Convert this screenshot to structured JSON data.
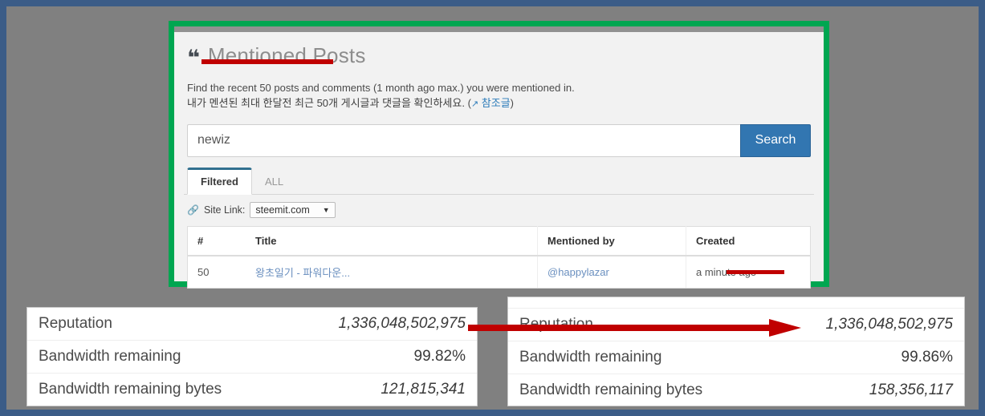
{
  "frame": {
    "border_color": "#3b5c87",
    "background_color": "#808080"
  },
  "annotations": {
    "highlight_box_color": "#00a651",
    "underline_color": "#c00000",
    "arrow_color": "#c00000"
  },
  "card": {
    "quote_icon": "quote-icon",
    "title": "Mentioned Posts",
    "description_en": "Find the recent 50 posts and comments (1 month ago max.) you were mentioned in.",
    "description_kr": "내가 멘션된 최대 한달전 최근 50개 게시글과 댓글을 확인하세요.",
    "ref_open_paren": "(",
    "ref_link_label": "참조글",
    "ref_close_paren": ")",
    "search": {
      "value": "newiz",
      "placeholder": "",
      "button_label": "Search",
      "button_color": "#3276b1"
    },
    "tabs": [
      {
        "label": "Filtered",
        "active": true
      },
      {
        "label": "ALL",
        "active": false
      }
    ],
    "site_link": {
      "icon": "chain-link-icon",
      "label": "Site Link:",
      "selected": "steemit.com",
      "caret": "▼",
      "options": [
        "steemit.com"
      ]
    },
    "table": {
      "headers": {
        "num": "#",
        "title": "Title",
        "mentioned_by": "Mentioned by",
        "created": "Created"
      },
      "rows": [
        {
          "num": "50",
          "title": "왕초일기 - 파워다운...",
          "mentioned_by": "@happylazar",
          "created": "a minute ago"
        }
      ]
    }
  },
  "panel_left": {
    "rows": [
      {
        "label": "Reputation",
        "value": "1,336,048,502,975",
        "italic": true
      },
      {
        "label": "Bandwidth remaining",
        "value": "99.82%",
        "italic": false
      },
      {
        "label": "Bandwidth remaining bytes",
        "value": "121,815,341",
        "italic": true
      }
    ]
  },
  "panel_right": {
    "rows": [
      {
        "label": "Reputation",
        "value": "1,336,048,502,975",
        "italic": true
      },
      {
        "label": "Bandwidth remaining",
        "value": "99.86%",
        "italic": false
      },
      {
        "label": "Bandwidth remaining bytes",
        "value": "158,356,117",
        "italic": true
      }
    ]
  }
}
